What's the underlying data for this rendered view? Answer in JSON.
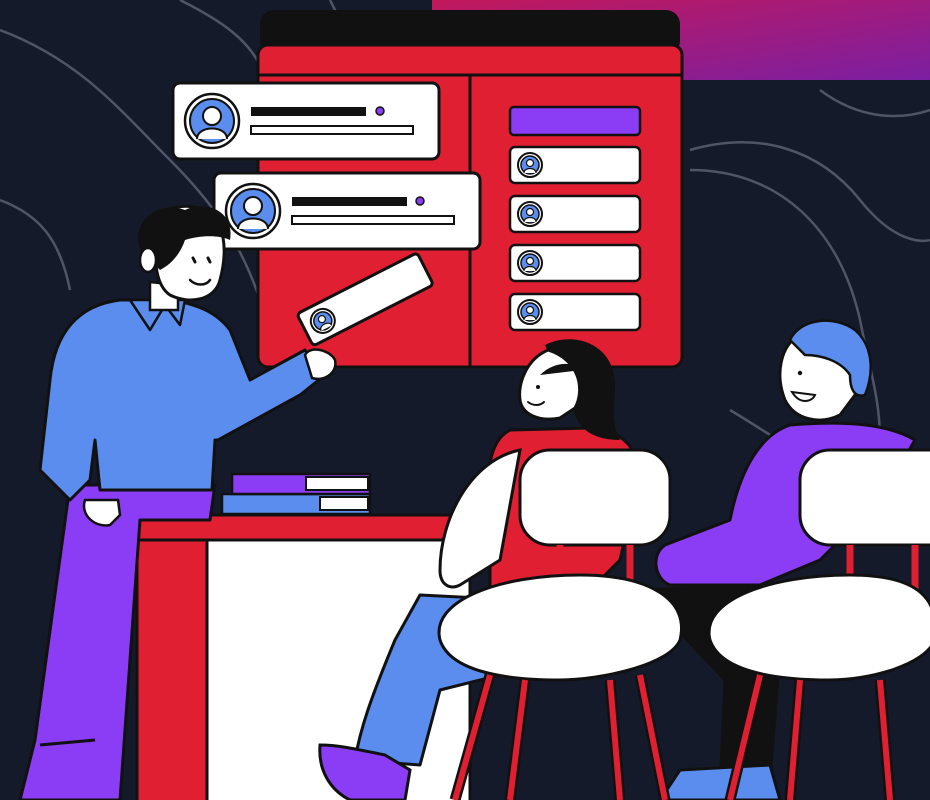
{
  "scene": {
    "colors": {
      "background": "#151a2b",
      "curves": "#5b6070",
      "corner_gradient_start": "#c2185b",
      "corner_gradient_end": "#7b1fa2",
      "board_red": "#e01f33",
      "board_dark": "#111111",
      "panel_purple": "#8b3cf5",
      "card_white": "#ffffff",
      "avatar_blue": "#5b8dee",
      "sweater_blue": "#5b8dee",
      "pants_purple": "#8b3cf5",
      "desk_red": "#e01f33",
      "desk_white": "#ffffff",
      "chair_white": "#ffffff",
      "chair_legs": "#e01f33",
      "outline": "#111111",
      "skin": "#ffffff",
      "hair_dark": "#111111",
      "hair_blue": "#5b8dee"
    },
    "figures": {
      "presenter": "presenter-man-holding-card",
      "listener_1": "seated-woman-red-top",
      "listener_2": "seated-man-purple-sweater"
    },
    "board": {
      "left_cards": 2,
      "right_list_items": 4,
      "handheld_card_icon": "user-avatar-icon"
    }
  }
}
